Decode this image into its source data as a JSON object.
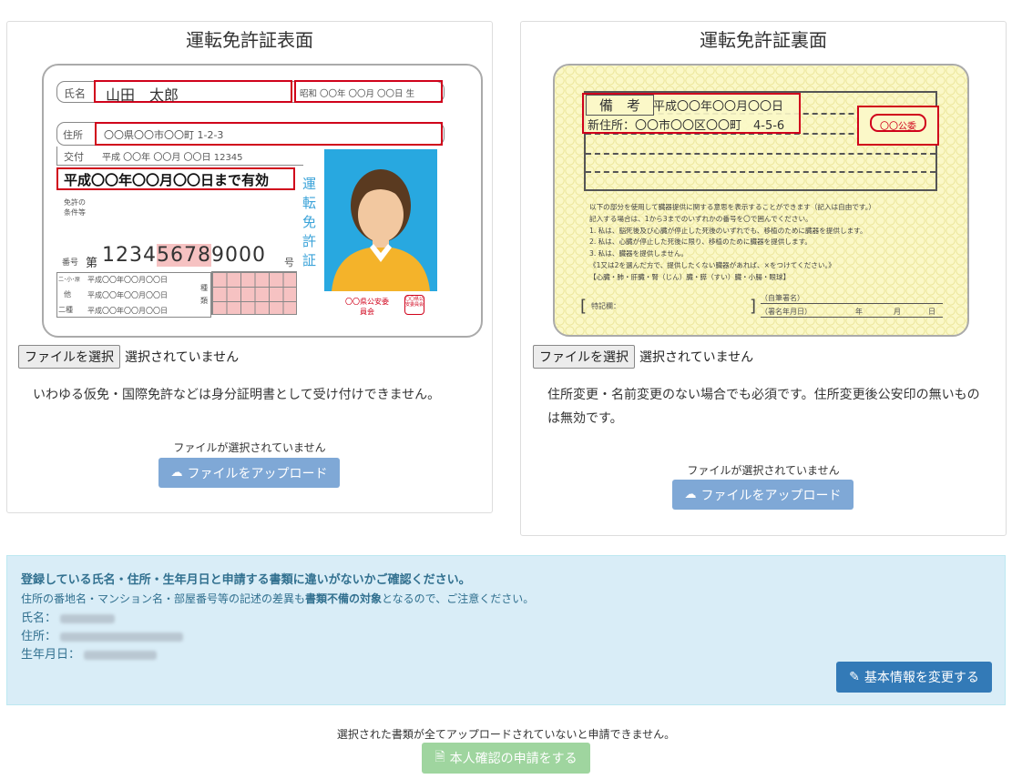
{
  "front": {
    "title": "運転免許証表面",
    "card": {
      "name_label": "氏名",
      "name_value": "山田　太郎",
      "birth": "昭和 〇〇年 〇〇月 〇〇日 生",
      "address_label": "住所",
      "address_value": "〇〇県〇〇市〇〇町 1-2-3",
      "issue_label": "交付",
      "issue_value": "平成 〇〇年 〇〇月 〇〇日 12345",
      "expiry": "平成〇〇年〇〇月〇〇日まで有効",
      "conditions_label": "免許の条件等",
      "number_label": "番号",
      "number_prefix": "第",
      "number_plain1": "1234",
      "number_highlight": "5678",
      "number_plain2": "9000",
      "number_suffix": "号",
      "vertical_label": "運転免許証",
      "history_labels": [
        "二･小･原",
        "他",
        "二種"
      ],
      "history_date": "平成〇〇年〇〇月〇〇日",
      "type_label": "種類",
      "issuer": "〇〇県公安委員会",
      "seal": "〇〇県公安委員会"
    },
    "file_button": "ファイルを選択",
    "file_status": "選択されていません",
    "note": "いわゆる仮免・国際免許などは身分証明書として受け付けできません。",
    "no_file": "ファイルが選択されていません",
    "upload_label": "ファイルをアップロード"
  },
  "back": {
    "title": "運転免許証裏面",
    "card": {
      "remarks_label": "備　考",
      "remarks_date": "平成〇〇年〇〇月〇〇日",
      "new_address": "新住所：〇〇市〇〇区〇〇町　4-5-6",
      "seal": "〇〇公委",
      "organ_text": [
        "以下の部分を使用して臓器提供に関する意思を表示することができます（記入は自由です。）",
        "記入する場合は、1から3までのいずれかの番号を〇で囲んでください。",
        "1. 私は、脳死後及び心臓が停止した死後のいずれでも、移植のために臓器を提供します。",
        "2. 私は、心臓が停止した死後に限り、移植のために臓器を提供します。",
        "3. 私は、臓器を提供しません。",
        "《1又は2を選んだ方で、提供したくない臓器があれば、×をつけてください。》",
        "【心臓・肺・肝臓・腎（じん）臓・膵（すい）臓・小腸・眼球】"
      ],
      "special_label": "特記欄：",
      "signature": "（自筆署名）",
      "signature_date": "（署名年月日）",
      "year": "年",
      "month": "月",
      "day": "日"
    },
    "file_button": "ファイルを選択",
    "file_status": "選択されていません",
    "note": "住所変更・名前変更のない場合でも必須です。住所変更後公安印の無いものは無効です。",
    "no_file": "ファイルが選択されていません",
    "upload_label": "ファイルをアップロード"
  },
  "info": {
    "heading": "登録している氏名・住所・生年月日と申請する書類に違いがないかご確認ください。",
    "caution_prefix": "住所の番地名・マンション名・部屋番号等の記述の差異も",
    "caution_bold": "書類不備の対象",
    "caution_suffix": "となるので、ご注意ください。",
    "name_label": "氏名：",
    "address_label": "住所：",
    "birth_label": "生年月日：",
    "edit_button": "基本情報を変更する"
  },
  "footer": {
    "note": "選択された書類が全てアップロードされていないと申請できません。",
    "submit_label": "本人確認の申請をする"
  },
  "colors": {
    "upload": "#7fa8d6",
    "edit": "#337ab7",
    "submit": "#9fd59f",
    "info_bg": "#d9edf7",
    "red": "#d0021b"
  }
}
